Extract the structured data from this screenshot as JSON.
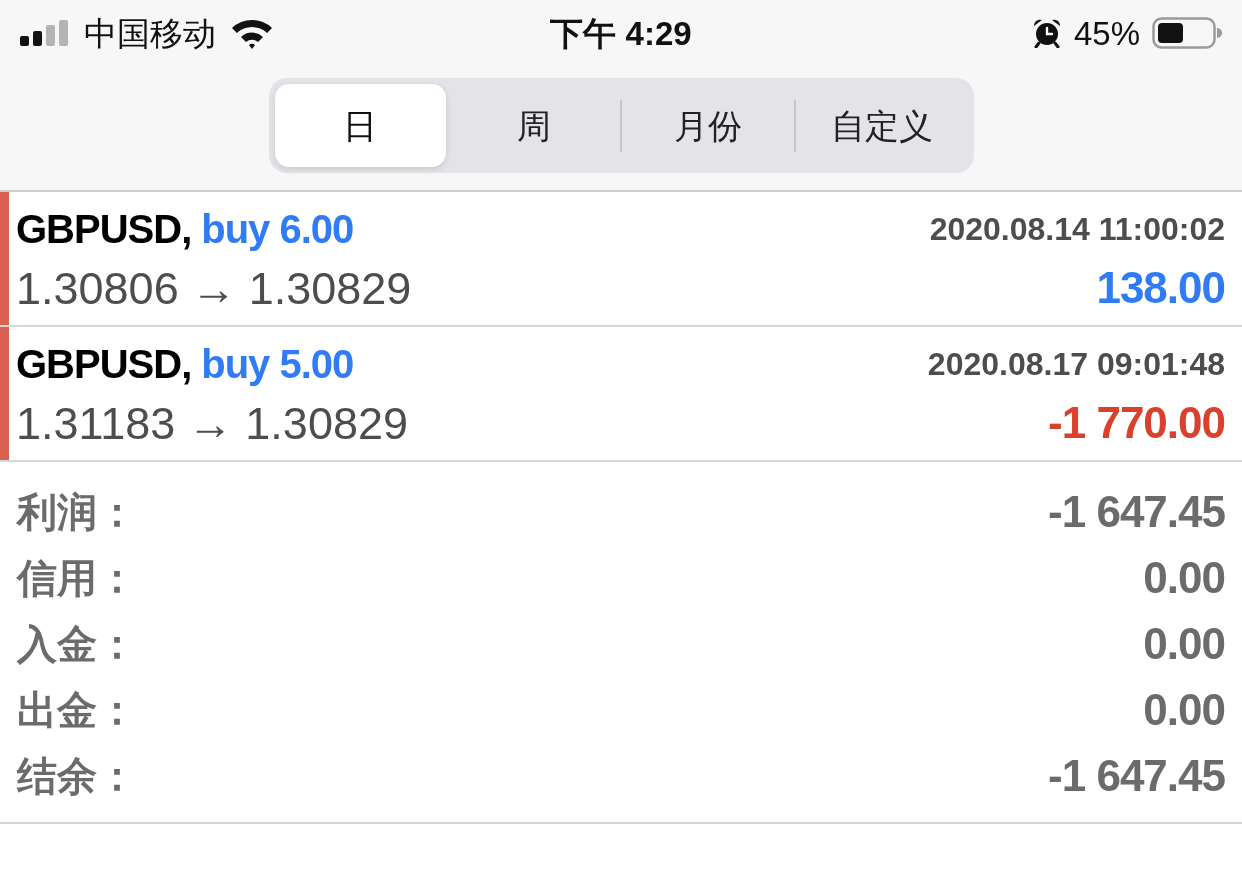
{
  "status_bar": {
    "carrier": "中国移动",
    "time": "下午 4:29",
    "battery": "45%"
  },
  "tabs": [
    {
      "label": "日",
      "selected": true
    },
    {
      "label": "周",
      "selected": false
    },
    {
      "label": "月份",
      "selected": false
    },
    {
      "label": "自定义",
      "selected": false
    }
  ],
  "deals": [
    {
      "symbol": "GBPUSD,",
      "side": "buy 6.00",
      "time": "2020.08.14 11:00:02",
      "prices": "1.30806 → 1.30829",
      "profit": "138.00",
      "color": "#2f7cf6"
    },
    {
      "symbol": "GBPUSD,",
      "side": "buy 5.00",
      "time": "2020.08.17 09:01:48",
      "prices": "1.31183 → 1.30829",
      "profit": "-1 770.00",
      "color": "#d9412e"
    }
  ],
  "summary": [
    {
      "label": "利润：",
      "value": "-1 647.45"
    },
    {
      "label": "信用：",
      "value": "0.00"
    },
    {
      "label": "入金：",
      "value": "0.00"
    },
    {
      "label": "出金：",
      "value": "0.00"
    },
    {
      "label": "结余：",
      "value": "-1 647.45"
    }
  ]
}
